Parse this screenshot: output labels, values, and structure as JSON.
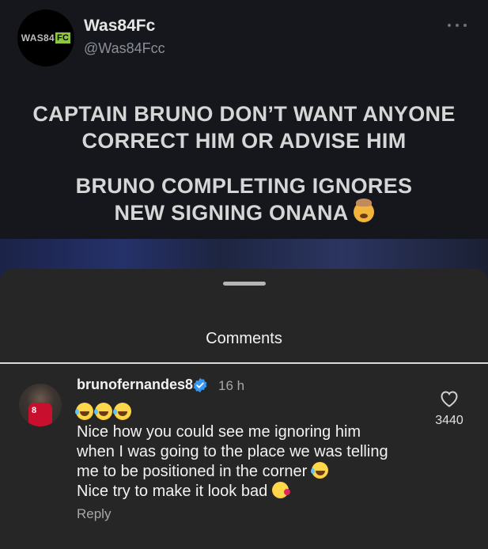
{
  "post": {
    "avatar_text": "WAS84",
    "avatar_badge": "FC",
    "display_name": "Was84Fc",
    "handle": "@Was84Fcc",
    "more_icon": "more-horizontal-icon",
    "headline_1_line_1": "CAPTAIN BRUNO DON’T WANT ANYONE",
    "headline_1_line_2": "CORRECT HIM OR ADVISE HIM",
    "headline_2_line_1": "BRUNO COMPLETING IGNORES",
    "headline_2_line_2": "NEW SIGNING ONANA",
    "headline_emoji": "exploding-head-emoji"
  },
  "comments_sheet": {
    "title": "Comments",
    "comments": [
      {
        "username": "brunofernandes8",
        "verified": true,
        "time": "16 h",
        "avatar_number": "8",
        "emoji_prefix": [
          "laughing-emoji",
          "laughing-emoji",
          "laughing-emoji"
        ],
        "lines": [
          "Nice how you could see me ignoring him",
          "when I was going to the place we was telling",
          "me to be positioned in the corner",
          "Nice try to make it look bad"
        ],
        "reply_label": "Reply",
        "like_count": "3440"
      }
    ]
  },
  "colors": {
    "background": "#262626",
    "post_background": "#15171c",
    "verified_blue": "#3897f0",
    "badge_green": "#8cc63f"
  }
}
